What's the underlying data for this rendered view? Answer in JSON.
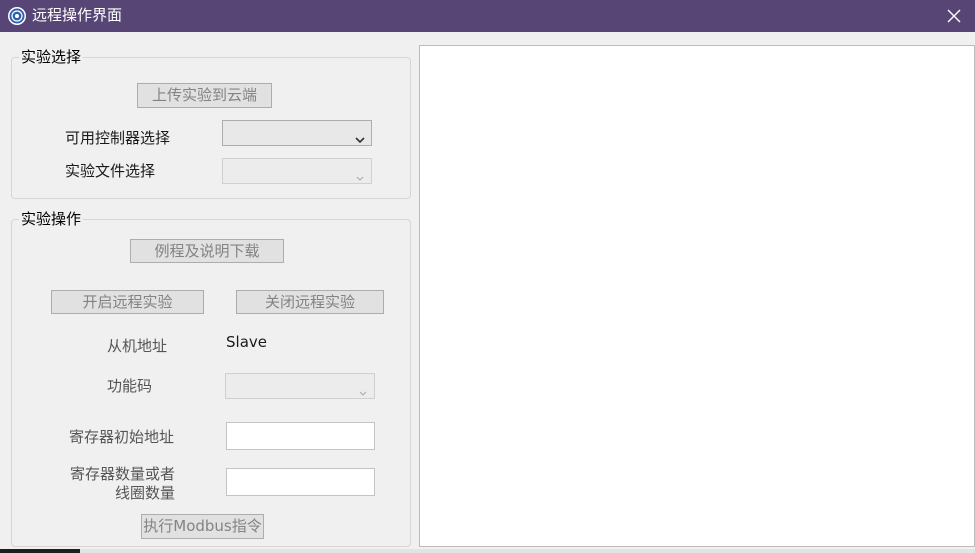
{
  "window": {
    "title": "远程操作界面",
    "titlebar_color": "#574576",
    "icon": "app-logo-icon",
    "close_icon": "close-icon"
  },
  "experiment_select": {
    "title": "实验选择",
    "upload_label": "上传实验到云端",
    "controller_label": "可用控制器选择",
    "controller_value": "",
    "file_label": "实验文件选择",
    "file_value": ""
  },
  "experiment_ops": {
    "title": "实验操作",
    "download_label": "例程及说明下载",
    "start_label": "开启远程实验",
    "stop_label": "关闭远程实验",
    "slave_addr_label": "从机地址",
    "slave_addr_value": "Slave",
    "function_code_label": "功能码",
    "function_code_value": "",
    "register_start_label": "寄存器初始地址",
    "register_start_value": "",
    "register_count_label_line1": "寄存器数量或者",
    "register_count_label_line2": "线圈数量",
    "register_count_value": "",
    "execute_label": "执行Modbus指令"
  }
}
